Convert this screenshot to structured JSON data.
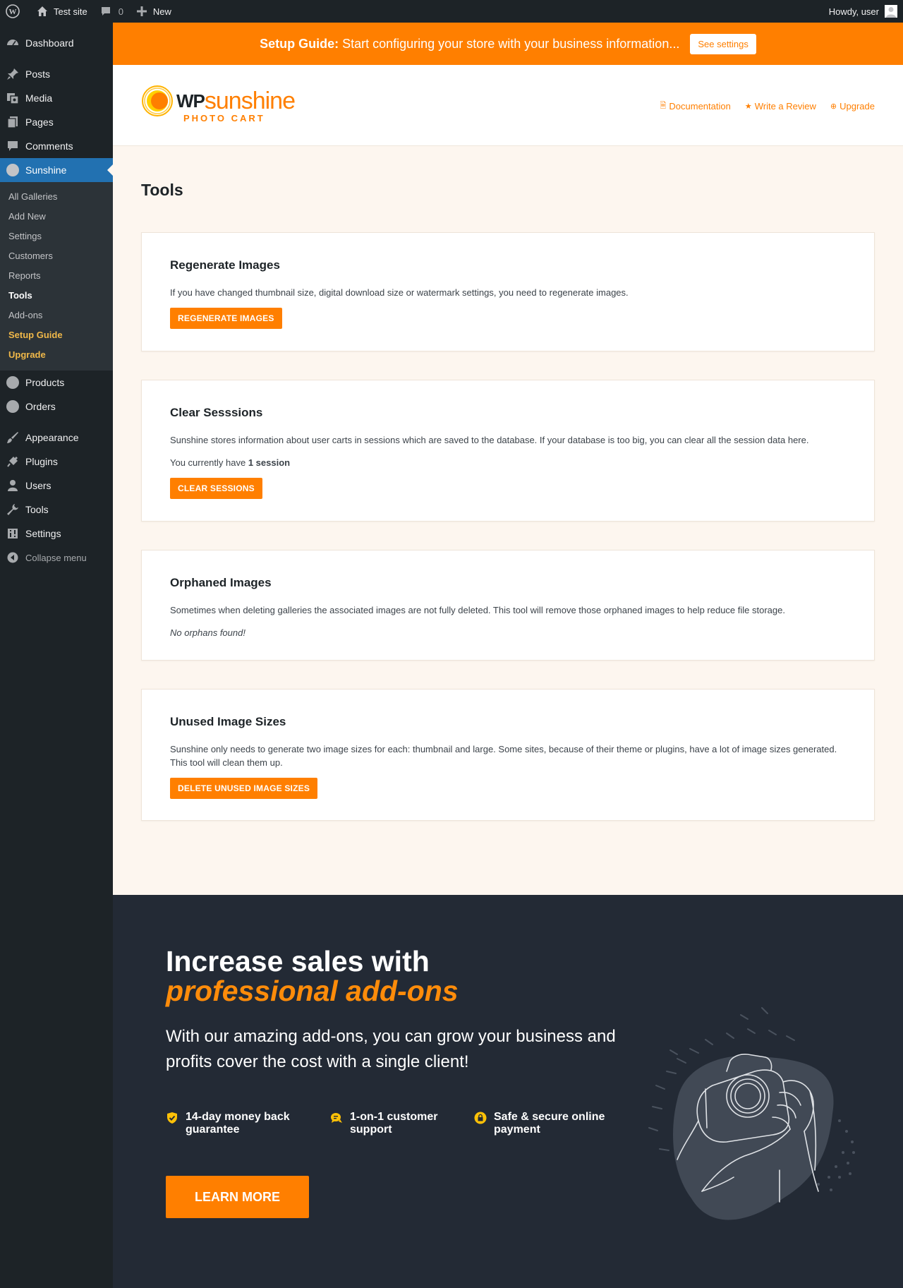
{
  "adminbar": {
    "site_name": "Test site",
    "comments_count": "0",
    "new_label": "New",
    "howdy": "Howdy, user"
  },
  "sidebar": {
    "items_top": [
      {
        "label": "Dashboard",
        "icon": "dashboard-icon"
      }
    ],
    "items_main": [
      {
        "label": "Posts",
        "icon": "pin-icon"
      },
      {
        "label": "Media",
        "icon": "media-icon"
      },
      {
        "label": "Pages",
        "icon": "pages-icon"
      },
      {
        "label": "Comments",
        "icon": "comment-icon"
      }
    ],
    "active": {
      "label": "Sunshine",
      "icon": "sunshine-icon"
    },
    "submenu": [
      {
        "label": "All Galleries",
        "style": "normal"
      },
      {
        "label": "Add New",
        "style": "normal"
      },
      {
        "label": "Settings",
        "style": "normal"
      },
      {
        "label": "Customers",
        "style": "normal"
      },
      {
        "label": "Reports",
        "style": "normal"
      },
      {
        "label": "Tools",
        "style": "current"
      },
      {
        "label": "Add-ons",
        "style": "normal"
      },
      {
        "label": "Setup Guide",
        "style": "orange"
      },
      {
        "label": "Upgrade",
        "style": "orange"
      }
    ],
    "items_shop": [
      {
        "label": "Products",
        "icon": "sunshine-icon"
      },
      {
        "label": "Orders",
        "icon": "sunshine-icon"
      }
    ],
    "items_admin": [
      {
        "label": "Appearance",
        "icon": "brush-icon"
      },
      {
        "label": "Plugins",
        "icon": "plug-icon"
      },
      {
        "label": "Users",
        "icon": "user-icon"
      },
      {
        "label": "Tools",
        "icon": "wrench-icon"
      },
      {
        "label": "Settings",
        "icon": "settings-icon"
      }
    ],
    "collapse": "Collapse menu"
  },
  "banner": {
    "strong": "Setup Guide:",
    "text": "Start configuring your store with your business information...",
    "button": "See settings"
  },
  "header": {
    "logo_wp": "WP",
    "logo_sunshine": "sunshine",
    "logo_sub": "PHOTO CART",
    "links": [
      "Documentation",
      "Write a Review",
      "Upgrade"
    ]
  },
  "page": {
    "title": "Tools",
    "cards": {
      "regen": {
        "title": "Regenerate Images",
        "desc": "If you have changed thumbnail size, digital download size or watermark settings, you need to regenerate images.",
        "button": "REGENERATE IMAGES"
      },
      "sessions": {
        "title": "Clear Sesssions",
        "desc": "Sunshine stores information about user carts in sessions which are saved to the database. If your database is too big, you can clear all the session data here.",
        "count_prefix": "You currently have",
        "count_value": "1 session",
        "button": "CLEAR SESSIONS"
      },
      "orphans": {
        "title": "Orphaned Images",
        "desc": "Sometimes when deleting galleries the associated images are not fully deleted. This tool will remove those orphaned images to help reduce file storage.",
        "status": "No orphans found!"
      },
      "sizes": {
        "title": "Unused Image Sizes",
        "desc": "Sunshine only needs to generate two image sizes for each: thumbnail and large. Some sites, because of their theme or plugins, have a lot of image sizes generated. This tool will clean them up.",
        "button": "DELETE UNUSED IMAGE SIZES"
      }
    }
  },
  "promo": {
    "headline": "Increase sales with",
    "headline_accent": "professional add-ons",
    "lead": "With our amazing add-ons, you can grow your business and profits cover the cost with a single client!",
    "features": [
      {
        "line1": "14-day money back",
        "line2": "guarantee",
        "icon": "shield-check-icon"
      },
      {
        "line1": "1-on-1 customer",
        "line2": "support",
        "icon": "chat-icon"
      },
      {
        "line1": "Safe & secure online",
        "line2": "payment",
        "icon": "lock-icon"
      }
    ],
    "button": "LEARN MORE"
  },
  "colors": {
    "accent": "#ff7f00",
    "admin_dark": "#1d2327",
    "active_blue": "#2271b1",
    "promo_bg": "#232a35"
  }
}
